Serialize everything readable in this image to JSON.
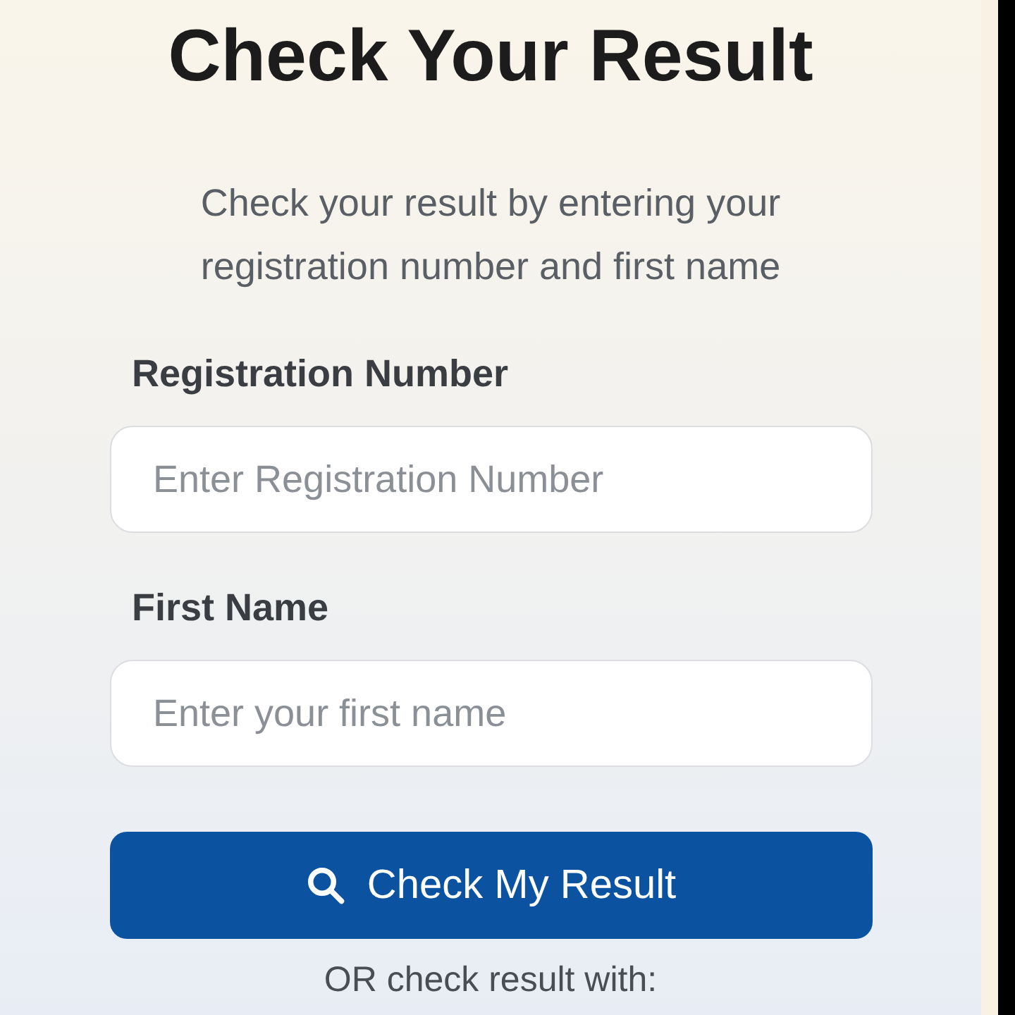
{
  "title": "Check Your Result",
  "subtitle": "Check your result by entering your registration number and first name",
  "fields": [
    {
      "label": "Registration Number",
      "placeholder": "Enter Registration Number"
    },
    {
      "label": "First Name",
      "placeholder": "Enter your first name"
    }
  ],
  "submit_button": {
    "label": "Check My Result"
  },
  "alternative_text": "OR check result with:"
}
